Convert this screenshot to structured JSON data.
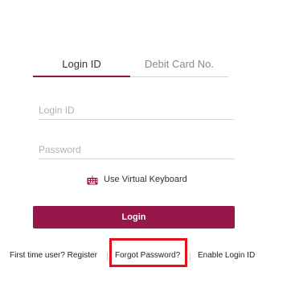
{
  "tabs": [
    {
      "label": "Login ID",
      "active": true
    },
    {
      "label": "Debit Card No.",
      "active": false
    }
  ],
  "form": {
    "login_id": {
      "value": "",
      "placeholder": "Login ID"
    },
    "password": {
      "value": "",
      "placeholder": "Password"
    }
  },
  "virtual_keyboard": {
    "icon": "keyboard-icon",
    "label": "Use Virtual Keyboard"
  },
  "login_button": {
    "label": "Login"
  },
  "footer_links": {
    "register": "First time user? Register",
    "forgot_password": "Forgot Password?",
    "enable_login_id": "Enable Login ID"
  },
  "colors": {
    "brand": "#98174a",
    "highlight": "#e3101e"
  }
}
